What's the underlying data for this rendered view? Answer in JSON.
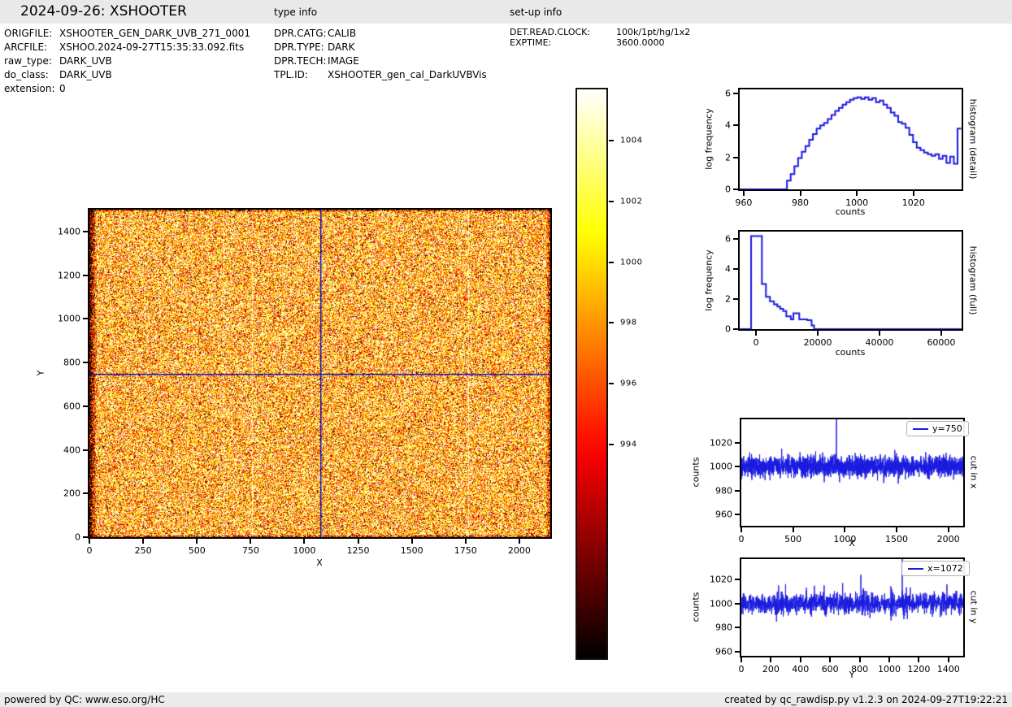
{
  "header": {
    "title": "2024-09-26: XSHOOTER",
    "type_info_label": "type info",
    "setup_info_label": "set-up info",
    "bar_color": "#e9e9e9"
  },
  "metadata": {
    "file_info": [
      {
        "label": "ORIGFILE:",
        "value": "XSHOOTER_GEN_DARK_UVB_271_0001"
      },
      {
        "label": "ARCFILE:",
        "value": "XSHOO.2024-09-27T15:35:33.092.fits"
      },
      {
        "label": "raw_type:",
        "value": "DARK_UVB"
      },
      {
        "label": "do_class:",
        "value": "DARK_UVB"
      },
      {
        "label": "extension:",
        "value": "0"
      }
    ],
    "type_info": [
      {
        "label": "DPR.CATG:",
        "value": "CALIB"
      },
      {
        "label": "DPR.TYPE:",
        "value": "DARK"
      },
      {
        "label": "DPR.TECH:",
        "value": "IMAGE"
      },
      {
        "label": "TPL.ID:",
        "value": "XSHOOTER_gen_cal_DarkUVBVis"
      }
    ],
    "setup_info": [
      {
        "label": "DET.READ.CLOCK:",
        "value": "100k/1pt/hg/1x2"
      },
      {
        "label": "EXPTIME:",
        "value": "3600.0000"
      }
    ]
  },
  "footer": {
    "left": "powered by QC: www.eso.org/HC",
    "right": "created by qc_rawdisp.py v1.2.3 on 2024-09-27T19:22:21",
    "bar_color": "#ebebeb"
  },
  "colors": {
    "line": "#1a1ae0",
    "crosshair": "#0000bb",
    "axis": "#000000"
  },
  "chart_data": [
    {
      "id": "main-image",
      "type": "heatmap",
      "xlabel": "X",
      "ylabel": "Y",
      "xlim": [
        0,
        2144
      ],
      "ylim": [
        0,
        1500
      ],
      "xticks": [
        0,
        250,
        500,
        750,
        1000,
        1250,
        1500,
        1750,
        2000
      ],
      "yticks": [
        0,
        200,
        400,
        600,
        800,
        1000,
        1200,
        1400
      ],
      "colormap": "hot",
      "value_range": [
        986.97,
        1005.68
      ],
      "pixel_mean": 1000,
      "pixel_sigma": 5.5,
      "seed": 42,
      "crosshair": {
        "x": 1072,
        "y": 750
      },
      "bright_columns": [
        624,
        756,
        1763
      ],
      "dark_edges": true
    },
    {
      "id": "colorbar",
      "type": "colorbar",
      "colormap": "hot",
      "range": [
        986.97,
        1005.68
      ],
      "ticks": [
        994,
        996,
        998,
        1000,
        1002,
        1004
      ]
    },
    {
      "id": "histogram-detail",
      "type": "step-histogram",
      "side_label": "histogram (detail)",
      "xlabel": "counts",
      "ylabel": "log frequency",
      "xlim": [
        958.6,
        1037
      ],
      "ylim": [
        0,
        6.25
      ],
      "xticks": [
        960,
        980,
        1000,
        1020
      ],
      "yticks": [
        0,
        2,
        4,
        6
      ],
      "bin_edges": [
        975.3,
        976.61,
        977.92,
        979.23,
        980.54,
        981.85,
        983.16,
        984.47,
        985.78,
        987.09,
        988.4,
        989.71,
        991.02,
        992.33,
        993.64,
        994.95,
        996.26,
        997.57,
        998.88,
        1000.19,
        1001.5,
        1002.81,
        1004.12,
        1005.43,
        1006.74,
        1008.05,
        1009.36,
        1010.67,
        1011.98,
        1013.29,
        1014.6,
        1015.91,
        1017.22,
        1018.53,
        1019.84,
        1021.15,
        1022.46,
        1023.77,
        1025.08,
        1026.39,
        1027.7,
        1029.01,
        1030.32,
        1031.63,
        1032.94,
        1034.25,
        1035.56,
        1036.9
      ],
      "log_freq": [
        0.55,
        0.95,
        1.45,
        1.95,
        2.35,
        2.7,
        3.1,
        3.45,
        3.8,
        4.0,
        4.15,
        4.4,
        4.65,
        4.9,
        5.1,
        5.3,
        5.45,
        5.6,
        5.7,
        5.75,
        5.65,
        5.75,
        5.6,
        5.7,
        5.45,
        5.55,
        5.3,
        5.1,
        4.8,
        4.6,
        4.2,
        4.1,
        3.85,
        3.4,
        2.95,
        2.6,
        2.45,
        2.3,
        2.2,
        2.1,
        2.2,
        1.9,
        2.1,
        1.65,
        2.05,
        1.6,
        3.8
      ]
    },
    {
      "id": "histogram-full",
      "type": "step-histogram",
      "side_label": "histogram (full)",
      "xlabel": "counts",
      "ylabel": "log frequency",
      "xlim": [
        -5300,
        66600
      ],
      "ylim": [
        0,
        6.5
      ],
      "xticks": [
        0,
        20000,
        40000,
        60000
      ],
      "yticks": [
        0,
        2,
        4,
        6
      ],
      "bin_edges": [
        -1600,
        1900,
        3200,
        4500,
        5800,
        6900,
        7800,
        8800,
        9800,
        11300,
        12100,
        14000,
        16600,
        18000,
        18800,
        66600
      ],
      "log_freq": [
        6.2,
        3.0,
        2.15,
        1.85,
        1.65,
        1.5,
        1.35,
        1.2,
        0.85,
        0.65,
        1.05,
        0.65,
        0.6,
        0.25,
        0.0
      ]
    },
    {
      "id": "cut-x",
      "type": "line",
      "legend": "y=750",
      "side_label": "cut in x",
      "xlabel": "X",
      "ylabel": "counts",
      "xlim": [
        0,
        2144
      ],
      "ylim": [
        950.5,
        1039.5
      ],
      "xticks": [
        0,
        500,
        1000,
        1500,
        2000
      ],
      "yticks": [
        960,
        980,
        1000,
        1020
      ],
      "noise": {
        "n": 2144,
        "mean": 1000,
        "sigma": 4.2,
        "seed": 7
      },
      "spikes": [
        {
          "x": 390,
          "value": 1015
        },
        {
          "x": 919,
          "value": 1039.5
        }
      ]
    },
    {
      "id": "cut-y",
      "type": "line",
      "legend": "x=1072",
      "side_label": "cut in y",
      "xlabel": "Y",
      "ylabel": "counts",
      "xlim": [
        0,
        1500
      ],
      "ylim": [
        956.5,
        1037
      ],
      "xticks": [
        0,
        200,
        400,
        600,
        800,
        1000,
        1200,
        1400
      ],
      "yticks": [
        960,
        980,
        1000,
        1020
      ],
      "noise": {
        "n": 1500,
        "mean": 1000,
        "sigma": 4.4,
        "seed": 13
      },
      "spikes": [
        {
          "x": 560,
          "value": 1015
        },
        {
          "x": 685,
          "value": 1017
        },
        {
          "x": 808,
          "value": 1024
        },
        {
          "x": 1088,
          "value": 1037
        },
        {
          "x": 1390,
          "value": 1016
        }
      ]
    }
  ]
}
